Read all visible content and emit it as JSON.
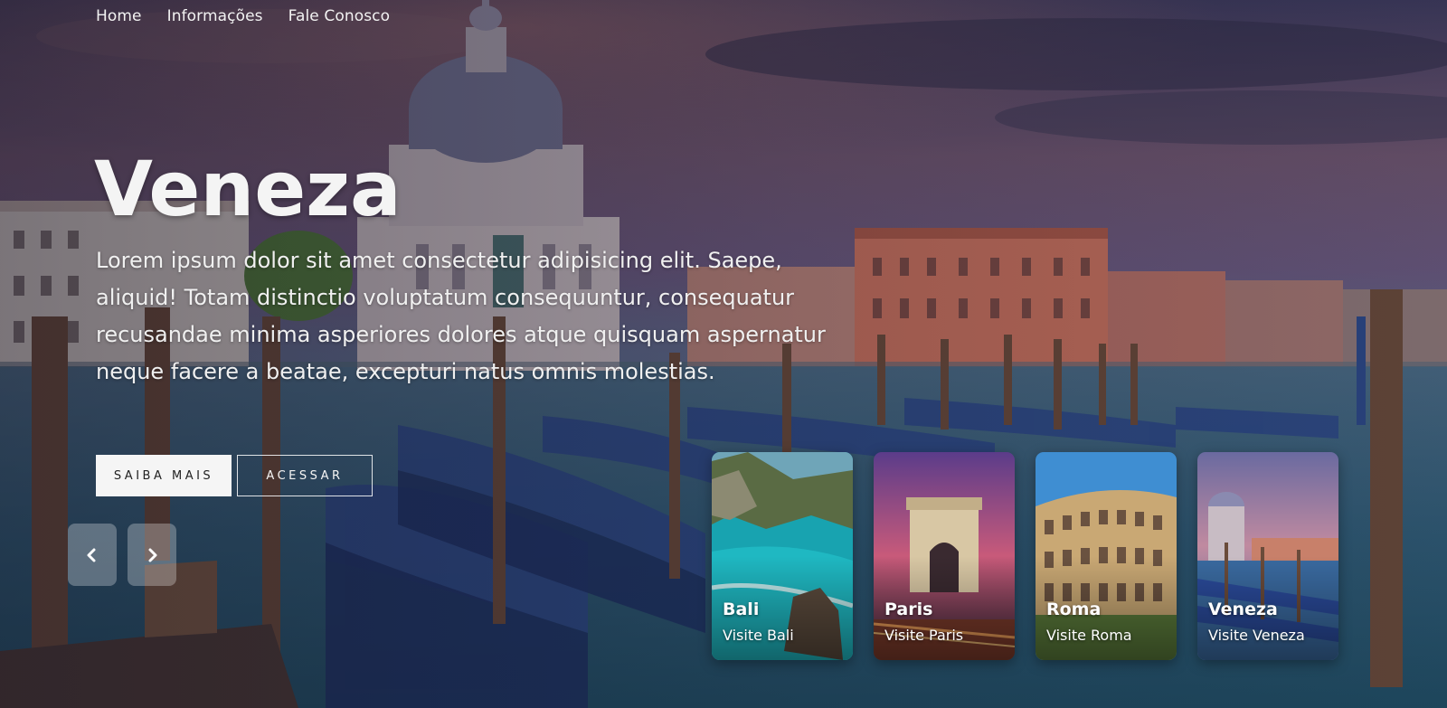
{
  "nav": {
    "items": [
      {
        "label": "Home"
      },
      {
        "label": "Informações"
      },
      {
        "label": "Fale Conosco"
      }
    ]
  },
  "hero": {
    "title": "Veneza",
    "description": "Lorem ipsum dolor sit amet consectetur adipisicing elit. Saepe, aliquid! Totam distinctio voluptatum consequuntur, consequatur recusandae minima asperiores dolores atque quisquam aspernatur neque facere a beatae, excepturi natus omnis molestias.",
    "primary_button": "SAIBA MAIS",
    "secondary_button": "ACESSAR"
  },
  "slider": {
    "prev_icon": "chevron-left-icon",
    "next_icon": "chevron-right-icon"
  },
  "cards": [
    {
      "name": "Bali",
      "subtitle": "Visite Bali"
    },
    {
      "name": "Paris",
      "subtitle": "Visite Paris"
    },
    {
      "name": "Roma",
      "subtitle": "Visite Roma"
    },
    {
      "name": "Veneza",
      "subtitle": "Visite Veneza"
    }
  ],
  "colors": {
    "sky_top": "#3c3a5c",
    "sky_mid": "#7a5a74",
    "water": "#2d5b78",
    "button_light": "#f5f5f5"
  }
}
